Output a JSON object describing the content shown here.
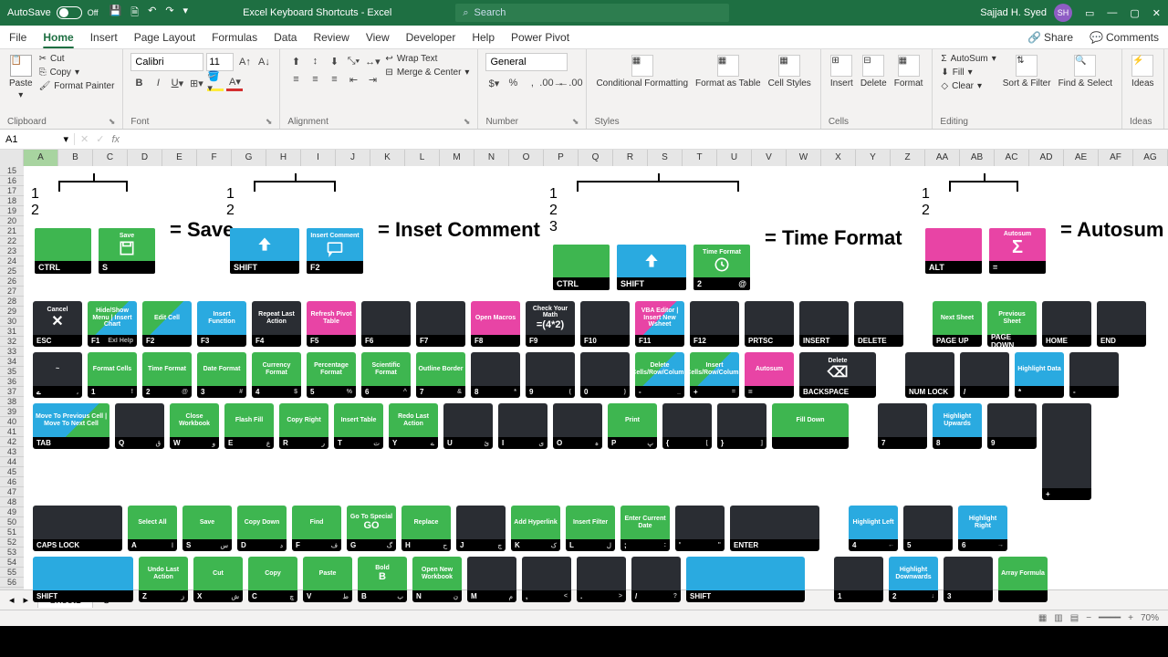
{
  "titlebar": {
    "autosave": "AutoSave",
    "autosave_state": "Off",
    "doctitle": "Excel Keyboard Shortcuts  -  Excel",
    "search_placeholder": "Search",
    "username": "Sajjad H. Syed",
    "avatar": "SH"
  },
  "tabs": [
    "File",
    "Home",
    "Insert",
    "Page Layout",
    "Formulas",
    "Data",
    "Review",
    "View",
    "Developer",
    "Help",
    "Power Pivot"
  ],
  "tabs_right": {
    "share": "Share",
    "comments": "Comments"
  },
  "ribbon": {
    "clipboard": {
      "paste": "Paste",
      "cut": "Cut",
      "copy": "Copy",
      "fp": "Format Painter",
      "label": "Clipboard"
    },
    "font": {
      "name": "Calibri",
      "size": "11",
      "label": "Font"
    },
    "alignment": {
      "wrap": "Wrap Text",
      "merge": "Merge & Center",
      "label": "Alignment"
    },
    "number": {
      "format": "General",
      "label": "Number"
    },
    "styles": {
      "cf": "Conditional Formatting",
      "fat": "Format as Table",
      "cs": "Cell Styles",
      "label": "Styles"
    },
    "cells": {
      "ins": "Insert",
      "del": "Delete",
      "fmt": "Format",
      "label": "Cells"
    },
    "editing": {
      "sum": "AutoSum",
      "fill": "Fill",
      "clear": "Clear",
      "sort": "Sort & Filter",
      "find": "Find & Select",
      "label": "Editing"
    },
    "ideas": {
      "label": "Ideas",
      "btn": "Ideas"
    }
  },
  "namebox": "A1",
  "cols": [
    "A",
    "B",
    "C",
    "D",
    "E",
    "F",
    "G",
    "H",
    "I",
    "J",
    "K",
    "L",
    "M",
    "N",
    "O",
    "P",
    "Q",
    "R",
    "S",
    "T",
    "U",
    "V",
    "W",
    "X",
    "Y",
    "Z",
    "AA",
    "AB",
    "AC",
    "AD",
    "AE",
    "AF",
    "AG"
  ],
  "rows_start": 15,
  "rows_end": 56,
  "shortcuts": {
    "save": {
      "k1": "CTRL",
      "k2": "S",
      "k2top": "Save",
      "label": "= Save"
    },
    "comment": {
      "k1": "SHIFT",
      "k2": "F2",
      "k2top": "Insert Comment",
      "label": "= Inset Comment"
    },
    "time": {
      "k1": "CTRL",
      "k2": "SHIFT",
      "k3": "2",
      "k3r": "@",
      "k3top": "Time Format",
      "label": "= Time Format"
    },
    "autosum": {
      "k1": "ALT",
      "k2": "=",
      "k2top": "Autosum",
      "label": "= Autosum"
    }
  },
  "keyboard": {
    "r1": [
      {
        "c": "dark",
        "t": "Cancel",
        "b": "ESC",
        "i": "✕"
      },
      {
        "c": "split",
        "t": "Hide/Show Menu | Insert Chart",
        "b": "F1",
        "br": "Exl Help"
      },
      {
        "c": "split",
        "t": "Edit Cell",
        "b": "F2"
      },
      {
        "c": "blue",
        "t": "Insert Function",
        "b": "F3"
      },
      {
        "c": "dark",
        "t": "Repeat Last Action",
        "b": "F4"
      },
      {
        "c": "magenta",
        "t": "Refresh Pivot Table",
        "b": "F5"
      },
      {
        "c": "dark",
        "t": "",
        "b": "F6"
      },
      {
        "c": "dark",
        "t": "",
        "b": "F7"
      },
      {
        "c": "magenta",
        "t": "Open Macros",
        "b": "F8"
      },
      {
        "c": "dark",
        "t": "Check Your Math",
        "b": "F9",
        "st": "=(4*2)"
      },
      {
        "c": "dark",
        "t": "",
        "b": "F10"
      },
      {
        "c": "splitmb",
        "t": "VBA Editor | Insert New Wsheet",
        "b": "F11"
      },
      {
        "c": "dark",
        "t": "",
        "b": "F12"
      },
      {
        "c": "dark",
        "t": "",
        "b": "PRTSC"
      },
      {
        "c": "dark",
        "t": "",
        "b": "INSERT"
      },
      {
        "c": "dark",
        "t": "",
        "b": "DELETE"
      }
    ],
    "r1b": [
      {
        "c": "green",
        "t": "Next Sheet",
        "b": "PAGE UP"
      },
      {
        "c": "green",
        "t": "Previous Sheet",
        "b": "PAGE DOWN"
      },
      {
        "c": "dark",
        "t": "",
        "b": "HOME"
      },
      {
        "c": "dark",
        "t": "",
        "b": "END"
      }
    ],
    "r2": [
      {
        "c": "dark",
        "t": "~",
        "b": "ے",
        "br": "،"
      },
      {
        "c": "green",
        "t": "Format Cells",
        "b": "1",
        "br": "!"
      },
      {
        "c": "green",
        "t": "Time Format",
        "b": "2",
        "br": "@"
      },
      {
        "c": "green",
        "t": "Date Format",
        "b": "3",
        "br": "#"
      },
      {
        "c": "green",
        "t": "Currency Format",
        "b": "4",
        "br": "$"
      },
      {
        "c": "green",
        "t": "Percentage Format",
        "b": "5",
        "br": "%"
      },
      {
        "c": "green",
        "t": "Scientific Format",
        "b": "6",
        "br": "^"
      },
      {
        "c": "green",
        "t": "Outline Border",
        "b": "7",
        "br": "&"
      },
      {
        "c": "dark",
        "t": "",
        "b": "8",
        "br": "*"
      },
      {
        "c": "dark",
        "t": "",
        "b": "9",
        "br": "("
      },
      {
        "c": "dark",
        "t": "",
        "b": "0",
        "br": ")"
      },
      {
        "c": "split",
        "t": "Delete Cells/Row/Column",
        "b": "-",
        "br": "_"
      },
      {
        "c": "split",
        "t": "Insert Cells/Row/Column",
        "b": "+",
        "br": "="
      },
      {
        "c": "magenta",
        "t": "Autosum",
        "b": "="
      },
      {
        "c": "dark",
        "t": "Delete",
        "b": "BACKSPACE",
        "i": "⌫",
        "w": "w15"
      }
    ],
    "r2b": [
      {
        "c": "dark",
        "t": "",
        "b": "NUM LOCK"
      },
      {
        "c": "dark",
        "t": "",
        "b": "/"
      },
      {
        "c": "blue",
        "t": "Highlight Data",
        "b": "*"
      },
      {
        "c": "dark",
        "t": "",
        "b": "-"
      }
    ],
    "r3": [
      {
        "c": "splitbg",
        "t": "Move To Previous Cell | Move To Next Cell",
        "b": "TAB",
        "w": "w15"
      },
      {
        "c": "dark",
        "t": "",
        "b": "Q",
        "br": "ق"
      },
      {
        "c": "green",
        "t": "Close Workbook",
        "b": "W",
        "br": "و"
      },
      {
        "c": "green",
        "t": "Flash Fill",
        "b": "E",
        "br": "ع"
      },
      {
        "c": "green",
        "t": "Copy Right",
        "b": "R",
        "br": "ر"
      },
      {
        "c": "green",
        "t": "Insert Table",
        "b": "T",
        "br": "ت"
      },
      {
        "c": "green",
        "t": "Redo Last Action",
        "b": "Y",
        "br": "ے"
      },
      {
        "c": "dark",
        "t": "",
        "b": "U",
        "br": "ئ"
      },
      {
        "c": "dark",
        "t": "",
        "b": "I",
        "br": "ی"
      },
      {
        "c": "dark",
        "t": "",
        "b": "O",
        "br": "ہ"
      },
      {
        "c": "green",
        "t": "Print",
        "b": "P",
        "br": "پ"
      },
      {
        "c": "dark",
        "t": "",
        "b": "{",
        "br": "["
      },
      {
        "c": "dark",
        "t": "",
        "b": "}",
        "br": "]"
      },
      {
        "c": "green",
        "t": "Fill Down",
        "b": "",
        "w": "w15"
      }
    ],
    "r3b": [
      {
        "c": "dark",
        "t": "",
        "b": "7"
      },
      {
        "c": "blue",
        "t": "Highlight Upwards",
        "b": "8"
      },
      {
        "c": "dark",
        "t": "",
        "b": "9"
      },
      {
        "c": "dark",
        "t": "",
        "b": "+",
        "h2": true
      }
    ],
    "r4": [
      {
        "c": "dark",
        "t": "",
        "b": "CAPS LOCK",
        "w": "w175"
      },
      {
        "c": "green",
        "t": "Select All",
        "b": "A",
        "br": "ا"
      },
      {
        "c": "green",
        "t": "Save",
        "b": "S",
        "br": "س"
      },
      {
        "c": "green",
        "t": "Copy Down",
        "b": "D",
        "br": "د"
      },
      {
        "c": "green",
        "t": "Find",
        "b": "F",
        "br": "ف"
      },
      {
        "c": "green",
        "t": "Go To Special",
        "b": "G",
        "br": "گ",
        "st": "GO"
      },
      {
        "c": "green",
        "t": "Replace",
        "b": "H",
        "br": "ح"
      },
      {
        "c": "dark",
        "t": "",
        "b": "J",
        "br": "ج"
      },
      {
        "c": "green",
        "t": "Add Hyperlink",
        "b": "K",
        "br": "ک"
      },
      {
        "c": "green",
        "t": "Insert Filter",
        "b": "L",
        "br": "ل"
      },
      {
        "c": "green",
        "t": "Enter Current Date",
        "b": ";",
        "br": ":"
      },
      {
        "c": "dark",
        "t": "",
        "b": "'",
        "br": "\""
      },
      {
        "c": "dark",
        "t": "",
        "b": "ENTER",
        "w": "w175"
      }
    ],
    "r4b": [
      {
        "c": "blue",
        "t": "Highlight Left",
        "b": "4",
        "br": "←"
      },
      {
        "c": "dark",
        "t": "",
        "b": "5"
      },
      {
        "c": "blue",
        "t": "Highlight Right",
        "b": "6",
        "br": "→"
      }
    ],
    "r5": [
      {
        "c": "blue",
        "t": "",
        "b": "SHIFT",
        "w": "w2"
      },
      {
        "c": "green",
        "t": "Undo Last Action",
        "b": "Z",
        "br": "ز"
      },
      {
        "c": "green",
        "t": "Cut",
        "b": "X",
        "br": "ش"
      },
      {
        "c": "green",
        "t": "Copy",
        "b": "C",
        "br": "چ"
      },
      {
        "c": "green",
        "t": "Paste",
        "b": "V",
        "br": "ط"
      },
      {
        "c": "green",
        "t": "Bold",
        "b": "B",
        "br": "ب",
        "st": "B"
      },
      {
        "c": "green",
        "t": "Open New Workbook",
        "b": "N",
        "br": "ن"
      },
      {
        "c": "dark",
        "t": "",
        "b": "M",
        "br": "م"
      },
      {
        "c": "dark",
        "t": "",
        "b": ",",
        "br": "<"
      },
      {
        "c": "dark",
        "t": "",
        "b": ".",
        "br": ">"
      },
      {
        "c": "dark",
        "t": "",
        "b": "/",
        "br": "?"
      },
      {
        "c": "blue",
        "t": "",
        "b": "SHIFT",
        "w": "w25"
      }
    ],
    "r5b": [
      {
        "c": "dark",
        "t": "",
        "b": "1"
      },
      {
        "c": "blue",
        "t": "Highlight Downwards",
        "b": "2",
        "br": "↓"
      },
      {
        "c": "dark",
        "t": "",
        "b": "3"
      },
      {
        "c": "green",
        "t": "Array Formula",
        "b": ""
      }
    ]
  },
  "sheettab": "Sheet1",
  "zoom": "70%"
}
